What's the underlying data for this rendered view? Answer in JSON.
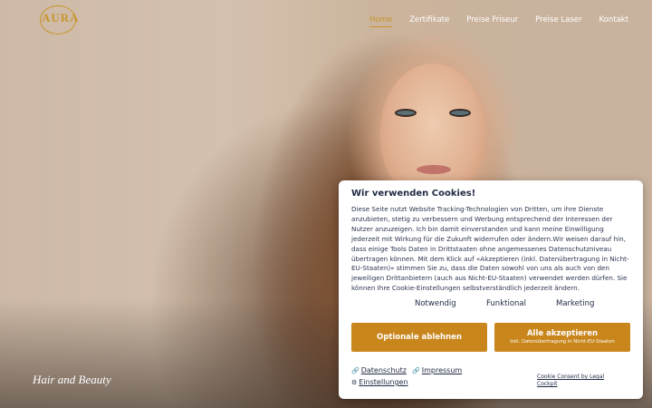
{
  "brand": {
    "logo_text": "AURA",
    "accent_color": "#c8962b"
  },
  "nav": {
    "items": [
      {
        "label": "Home",
        "active": true
      },
      {
        "label": "Zertifikate"
      },
      {
        "label": "Preise Friseur"
      },
      {
        "label": "Preise Laser"
      },
      {
        "label": "Kontakt"
      }
    ]
  },
  "hero": {
    "tagline": "Hair and Beauty"
  },
  "cookie": {
    "title": "Wir verwenden Cookies!",
    "body": "Diese Seite nutzt Website Tracking-Technologien von Dritten, um ihre Dienste anzubieten, stetig zu verbessern und Werbung entsprechend der Interessen der Nutzer anzuzeigen. Ich bin damit einverstanden und kann meine Einwilligung jederzeit mit Wirkung für die Zukunft widerrufen oder ändern.Wir weisen darauf hin, dass einige Tools Daten in Drittstaaten ohne angemessenes Datenschutzniveau übertragen können. Mit dem Klick auf «Akzeptieren (inkl. Datenübertragung in Nicht-EU-Staaten)» stimmen Sie zu, dass die Daten sowohl von uns als auch von den jeweiligen Drittanbietern (auch aus Nicht-EU-Staaten) verwendet werden dürfen. Sie können Ihre Cookie-Einstellungen selbstverständlich jederzeit ändern.",
    "categories": [
      "Notwendig",
      "Funktional",
      "Marketing"
    ],
    "reject_label": "Optionale ablehnen",
    "accept_label": "Alle akzeptieren",
    "accept_sub": "inkl. Datenübertragung in Nicht-EU-Staaten",
    "button_color": "#c8861d",
    "links": {
      "privacy": "Datenschutz",
      "imprint": "Impressum",
      "settings": "Einstellungen"
    },
    "credit": "Cookie Consent by Legal Cockpit"
  }
}
